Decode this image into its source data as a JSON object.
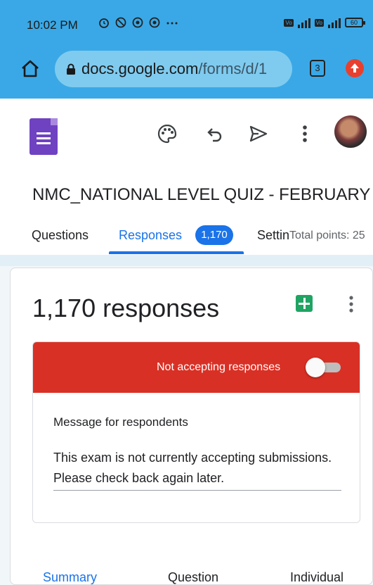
{
  "status_bar": {
    "time": "10:02 PM",
    "battery": "60",
    "left_icons": [
      "alarm-icon",
      "do-not-disturb-icon",
      "app-icon",
      "app-icon",
      "more-dots-icon"
    ]
  },
  "browser": {
    "url_host": "docs.google.com",
    "url_path": "/forms/d/1",
    "tab_count": "3"
  },
  "form": {
    "title": "NMC_NATIONAL LEVEL QUIZ - FEBRUARY"
  },
  "tabs": {
    "questions": "Questions",
    "responses": "Responses",
    "responses_badge": "1,170",
    "settings": "Settings",
    "total_points": "Total points: 25"
  },
  "responses_card": {
    "count_label": "1,170 responses",
    "accepting_label": "Not accepting responses",
    "accepting": false,
    "message_title": "Message for respondents",
    "message_body": "This exam is not currently accepting submissions. Please check back again later."
  },
  "bottom_tabs": {
    "summary": "Summary",
    "question": "Question",
    "individual": "Individual"
  },
  "colors": {
    "browser_bar": "#3aa8e6",
    "accent": "#1a73e8",
    "alert_red": "#d93025",
    "forms_purple": "#6f42c1",
    "sheets_green": "#1fa463"
  }
}
